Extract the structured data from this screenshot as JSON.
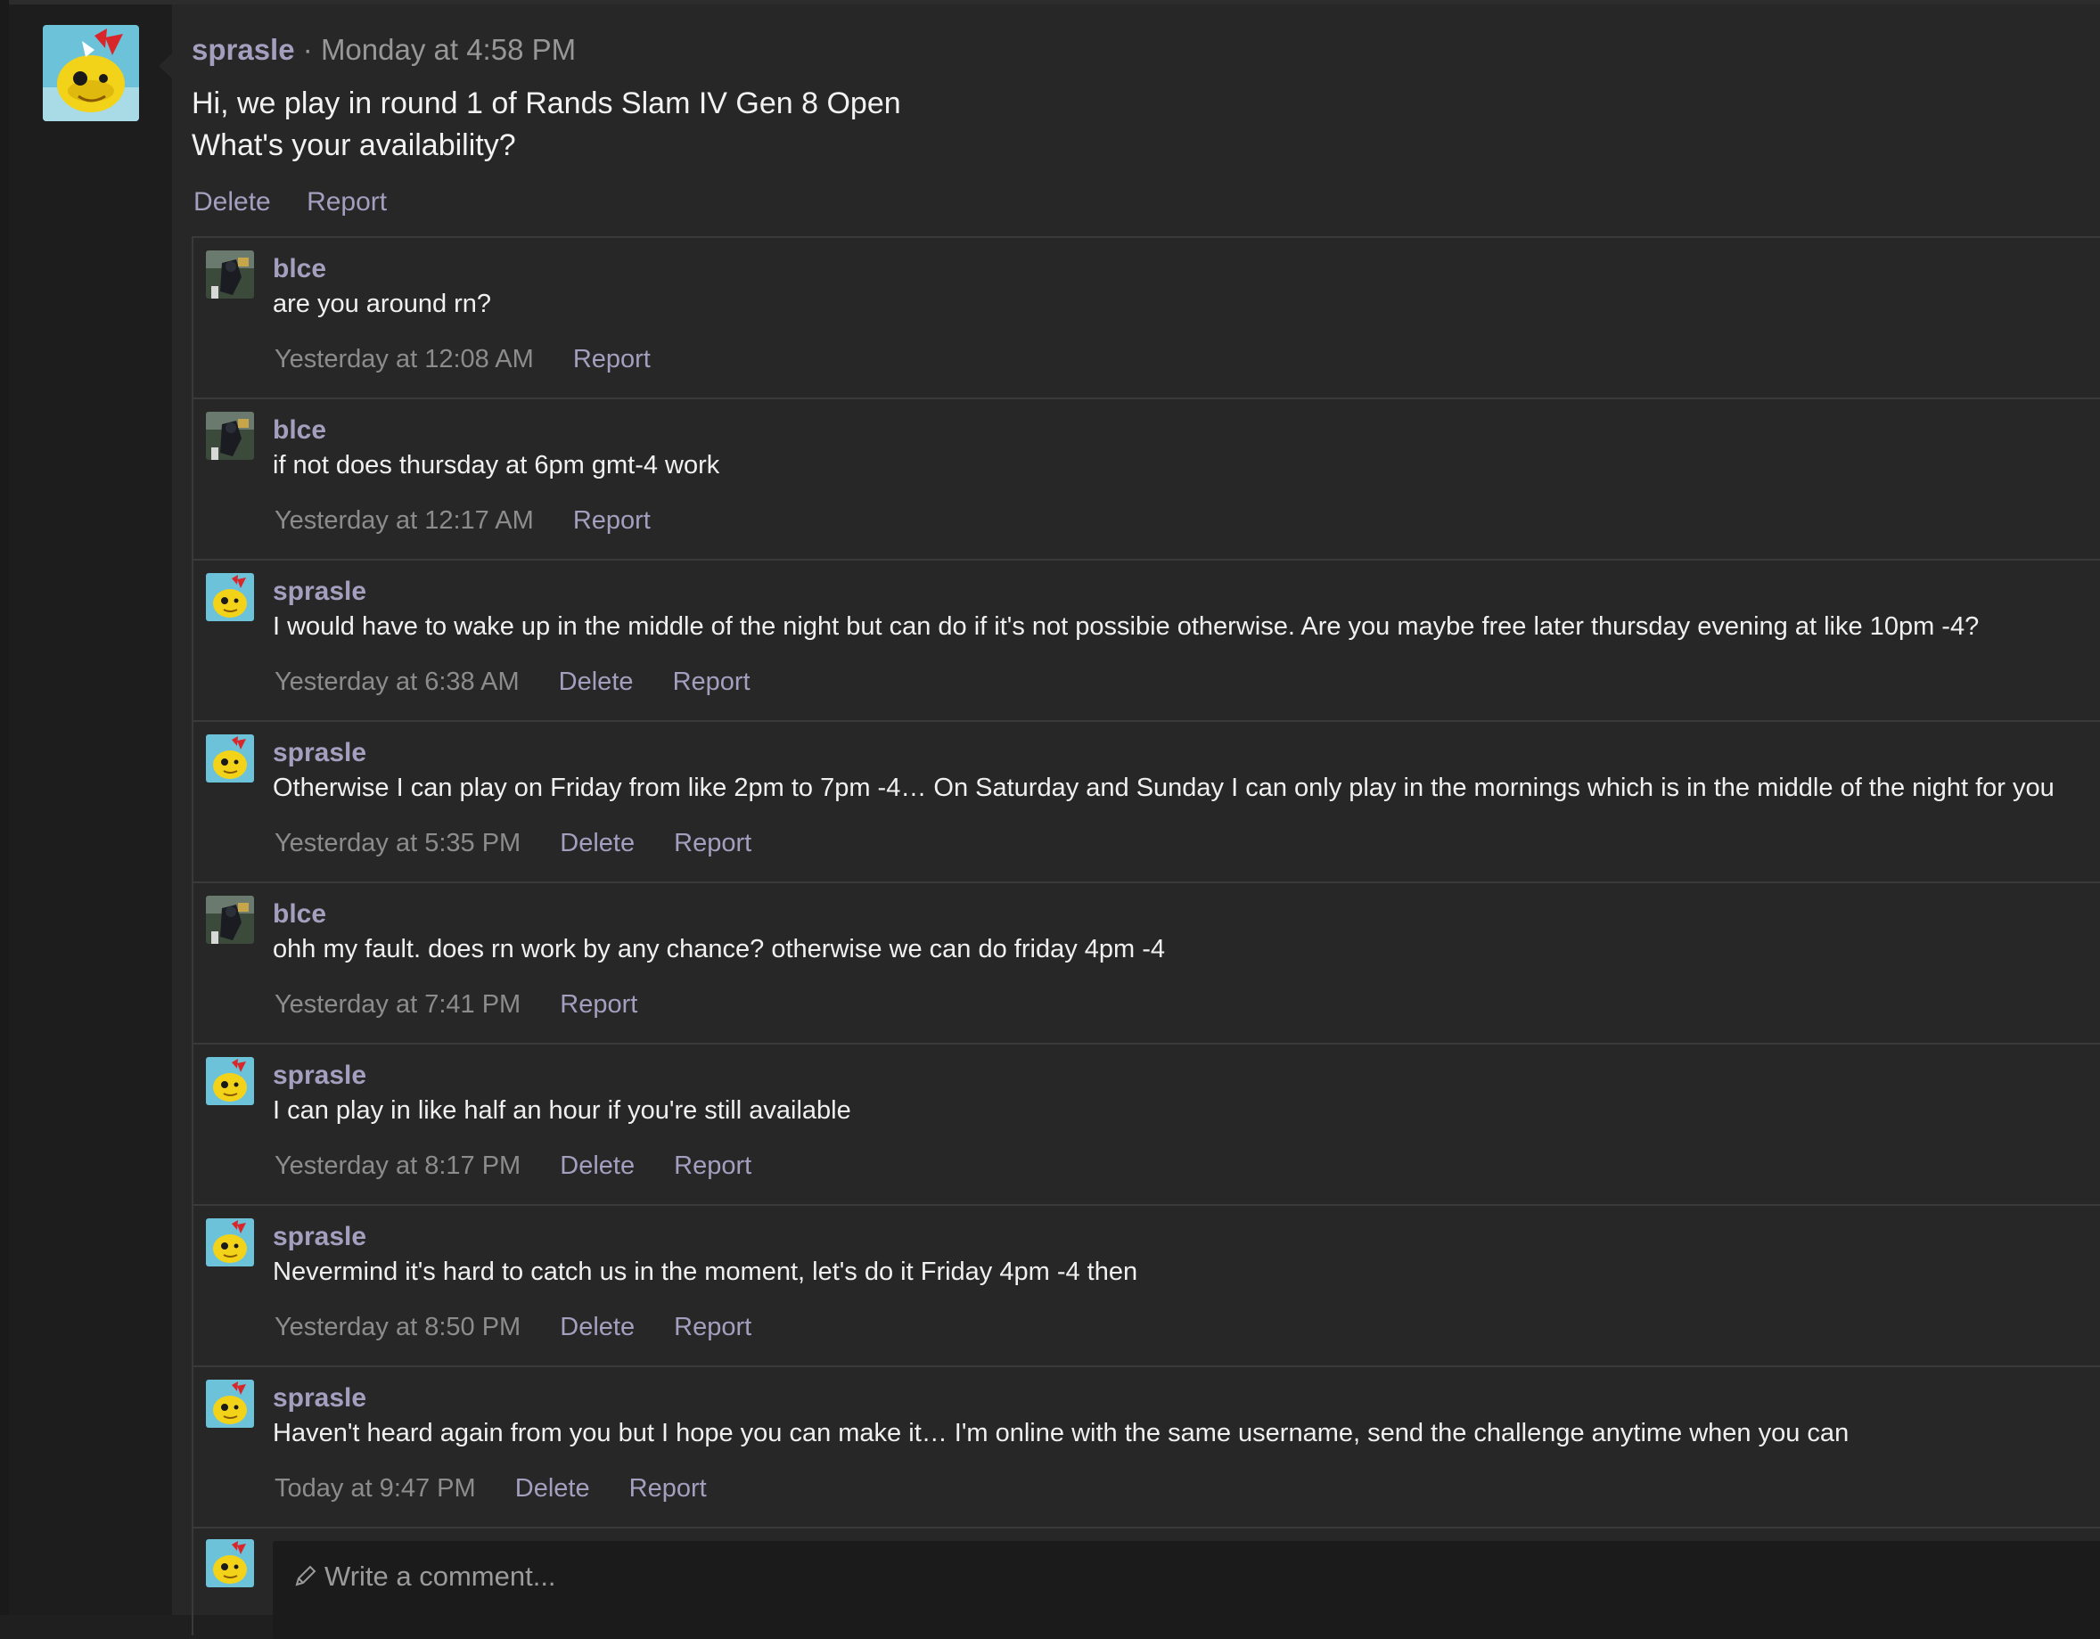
{
  "post": {
    "author": "sprasle",
    "separator": "·",
    "time": "Monday at 4:58 PM",
    "body_line1": "Hi, we play in round 1 of Rands Slam IV Gen 8 Open",
    "body_line2": "What's your availability?",
    "delete_label": "Delete",
    "report_label": "Report"
  },
  "comments": [
    {
      "user": "blce",
      "text": "are you around rn?",
      "time": "Yesterday at 12:08 AM",
      "report": "Report"
    },
    {
      "user": "blce",
      "text": "if not does thursday at 6pm gmt-4 work",
      "time": "Yesterday at 12:17 AM",
      "report": "Report"
    },
    {
      "user": "sprasle",
      "text": "I would have to wake up in the middle of the night but can do if it's not possibie otherwise. Are you maybe free later thursday evening at like 10pm -4?",
      "time": "Yesterday at 6:38 AM",
      "delete": "Delete",
      "report": "Report"
    },
    {
      "user": "sprasle",
      "text": "Otherwise I can play on Friday from like 2pm to 7pm -4… On Saturday and Sunday I can only play in the mornings which is in the middle of the night for you",
      "time": "Yesterday at 5:35 PM",
      "delete": "Delete",
      "report": "Report"
    },
    {
      "user": "blce",
      "text": "ohh my fault. does rn work by any chance? otherwise we can do friday 4pm -4",
      "time": "Yesterday at 7:41 PM",
      "report": "Report"
    },
    {
      "user": "sprasle",
      "text": "I can play in like half an hour if you're still available",
      "time": "Yesterday at 8:17 PM",
      "delete": "Delete",
      "report": "Report"
    },
    {
      "user": "sprasle",
      "text": "Nevermind it's hard to catch us in the moment, let's do it Friday 4pm -4 then",
      "time": "Yesterday at 8:50 PM",
      "delete": "Delete",
      "report": "Report"
    },
    {
      "user": "sprasle",
      "text": "Haven't heard again from you but I hope you can make it… I'm online with the same username, send the challenge anytime when you can",
      "time": "Today at 9:47 PM",
      "delete": "Delete",
      "report": "Report"
    }
  ],
  "composer": {
    "placeholder": "Write a comment..."
  },
  "colors": {
    "accent_link": "#a49fbf",
    "background": "#272727",
    "muted_time": "#8c8c8c"
  },
  "icons": {
    "sprasle_avatar": "yellow-pokemon-avatar-icon",
    "blce_avatar": "dark-character-avatar-icon",
    "composer": "pencil-icon"
  }
}
